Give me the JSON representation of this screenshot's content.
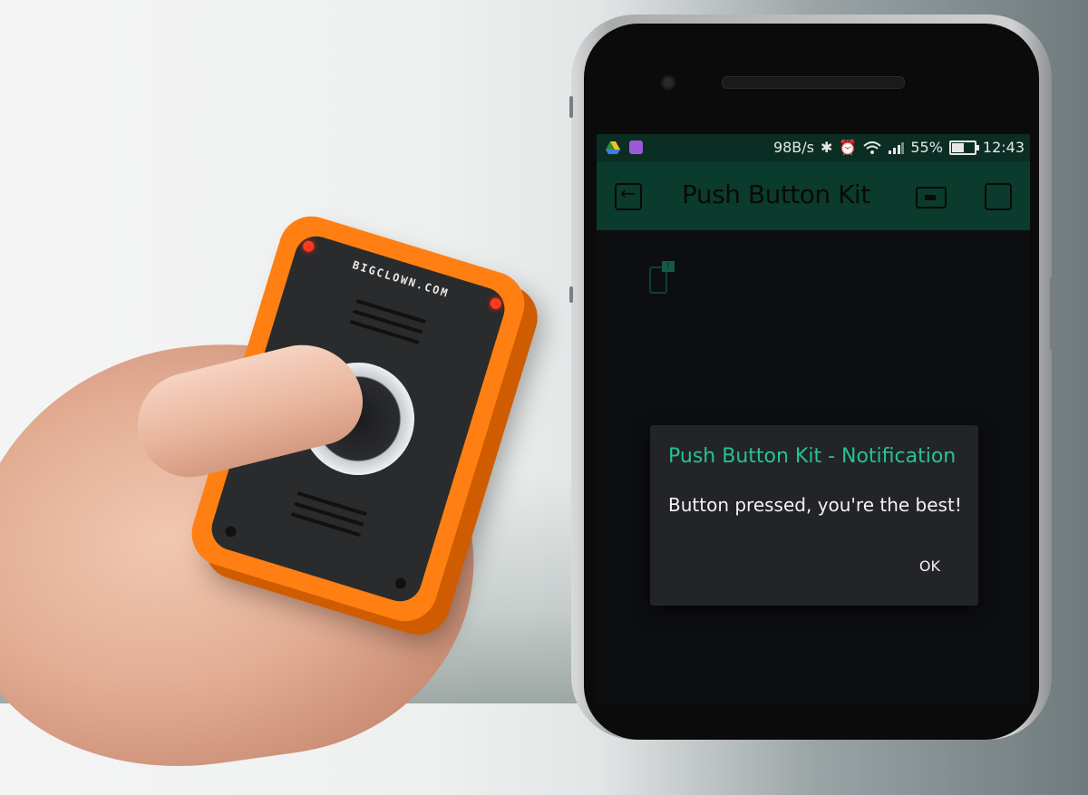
{
  "photo": {
    "brand_text": "BIGCLOWN.COM"
  },
  "status_bar": {
    "network_speed": "98B/s",
    "battery_percent": "55%",
    "time": "12:43",
    "left_icons": [
      "drive-icon",
      "photo-icon"
    ],
    "right_icons": [
      "bluetooth-icon",
      "alarm-icon",
      "wifi-icon",
      "signal-icon",
      "battery-icon"
    ]
  },
  "app_bar": {
    "title": "Push Button Kit",
    "icons": [
      "back-icon",
      "device-icon",
      "stop-icon"
    ],
    "background": "#0b3b2c"
  },
  "dialog": {
    "title": "Push Button Kit - Notification",
    "message": "Button pressed, you're the best!",
    "ok_label": "OK",
    "accent": "#24c48e"
  }
}
